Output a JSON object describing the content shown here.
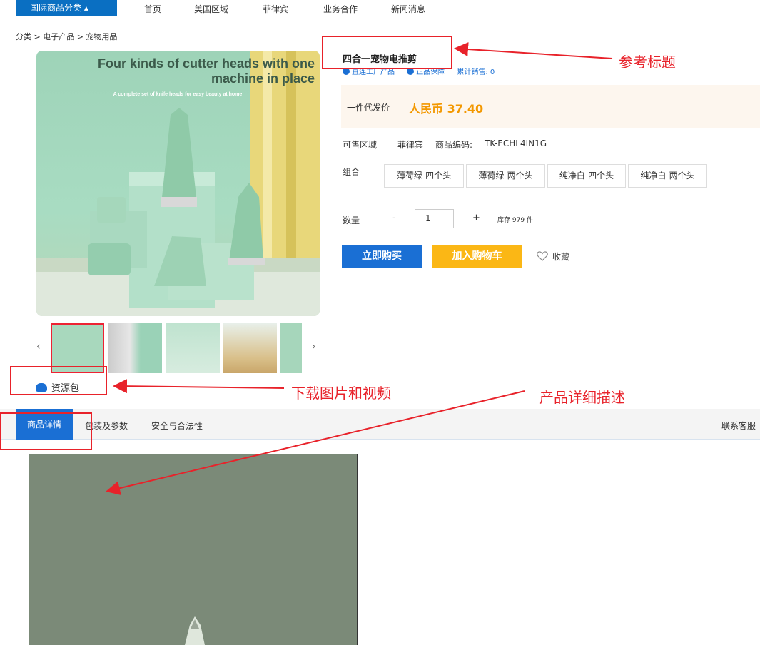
{
  "nav": {
    "category_btn": "国际商品分类 ▴",
    "items": [
      "首页",
      "美国区域",
      "菲律宾",
      "业务合作",
      "新闻消息"
    ]
  },
  "breadcrumb": "分类 > 电子产品 > 宠物用品",
  "gallery": {
    "main_heading": "Four kinds of cutter heads with one machine in place",
    "main_sub": "A complete set of knife heads for easy beauty at home",
    "prev": "‹",
    "next": "›",
    "resource_pack": "资源包"
  },
  "product": {
    "title": "四合一宠物电推剪",
    "badge_1": "直连工厂产品",
    "badge_2": "正品保障",
    "sales": "累计销售: 0",
    "price_label": "一件代发价",
    "price": "人民币 37.40",
    "region_label": "可售区域",
    "region": "菲律宾",
    "sku_label": "商品编码:",
    "sku": "TK-ECHL4IN1G",
    "combo_label": "组合",
    "combos": [
      "薄荷绿-四个头",
      "薄荷绿-两个头",
      "纯净白-四个头",
      "纯净白-两个头"
    ],
    "qty_label": "数量",
    "qty_minus": "-",
    "qty_value": "1",
    "qty_plus": "+",
    "stock": "库存 979 件",
    "buy_now": "立即购买",
    "add_cart": "加入购物车",
    "favorite": "收藏"
  },
  "tabs": {
    "items": [
      "商品详情",
      "包装及参数",
      "安全与合法性"
    ],
    "contact": "联系客服"
  },
  "annotations": {
    "ref_title": "参考标题",
    "download": "下载图片和视频",
    "detail_desc": "产品详细描述"
  },
  "colors": {
    "primary": "#1a6fd4",
    "price": "#f39800",
    "cart": "#fbb715",
    "annotation": "#e8222a"
  }
}
